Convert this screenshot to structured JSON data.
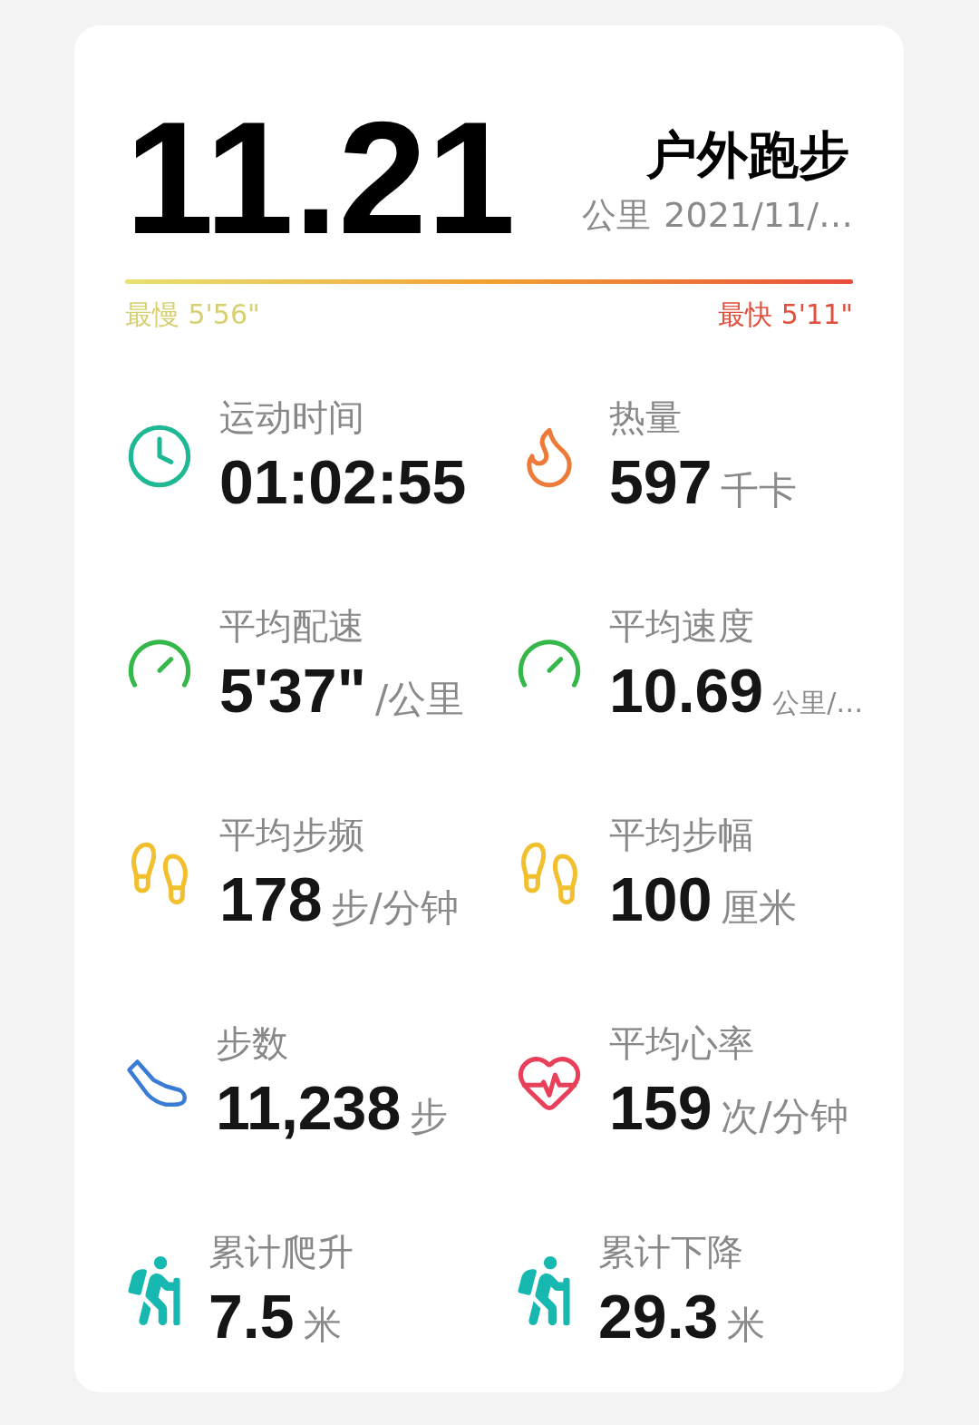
{
  "header": {
    "distance": "11.21",
    "unit": "公里",
    "date": "2021/11/…",
    "activity": "户外跑步"
  },
  "pace_bar": {
    "slowest": "最慢 5'56\"",
    "fastest": "最快 5'11\""
  },
  "stats": [
    {
      "kind": "clock",
      "label": "运动时间",
      "value": "01:02:55"
    },
    {
      "kind": "flame",
      "label": "热量",
      "value": "597",
      "unit": "千卡",
      "small": false
    },
    {
      "kind": "gauge",
      "label": "平均配速",
      "value": "5'37\"",
      "unit": "/公里",
      "small": false
    },
    {
      "kind": "gauge",
      "label": "平均速度",
      "value": "10.69",
      "unit": "公里/…",
      "small": true
    },
    {
      "kind": "footprints",
      "label": "平均步频",
      "value": "178",
      "unit": "步/分钟",
      "small": false
    },
    {
      "kind": "footprints",
      "label": "平均步幅",
      "value": "100",
      "unit": "厘米",
      "small": false
    },
    {
      "kind": "shoe",
      "label": "步数",
      "value": "11,238",
      "unit": "步",
      "small": false
    },
    {
      "kind": "heart",
      "label": "平均心率",
      "value": "159",
      "unit": "次/分钟",
      "small": false
    },
    {
      "kind": "hiker",
      "label": "累计爬升",
      "value": "7.5",
      "unit": "米",
      "small": false
    },
    {
      "kind": "hiker",
      "label": "累计下降",
      "value": "29.3",
      "unit": "米",
      "small": false
    }
  ]
}
